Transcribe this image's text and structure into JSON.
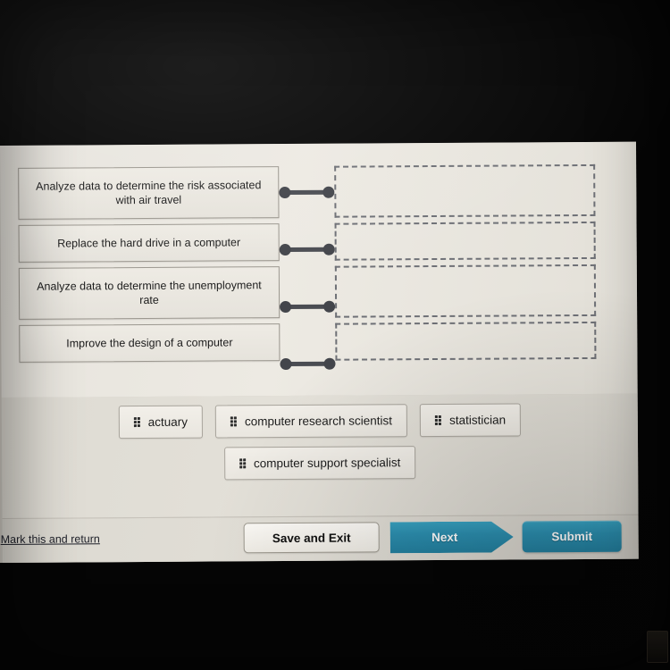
{
  "screen": {
    "prompts": [
      {
        "id": "prompt-1",
        "text": "Analyze data to determine the risk associated with air travel",
        "size": "tall"
      },
      {
        "id": "prompt-2",
        "text": "Replace the hard drive in a computer",
        "size": "short"
      },
      {
        "id": "prompt-3",
        "text": "Analyze data to determine the unemployment rate",
        "size": "tall"
      },
      {
        "id": "prompt-4",
        "text": "Improve the design of a computer",
        "size": "short"
      }
    ],
    "dropzones": [
      {
        "id": "dropzone-1",
        "value": "",
        "size": "tall"
      },
      {
        "id": "dropzone-2",
        "value": "",
        "size": "short"
      },
      {
        "id": "dropzone-3",
        "value": "",
        "size": "tall"
      },
      {
        "id": "dropzone-4",
        "value": "",
        "size": "short"
      }
    ],
    "tokens": {
      "row1": [
        {
          "id": "token-actuary",
          "label": "actuary",
          "icon": "drag-grip-icon"
        },
        {
          "id": "token-computer-research-scientist",
          "label": "computer research scientist",
          "icon": "drag-grip-icon"
        },
        {
          "id": "token-statistician",
          "label": "statistician",
          "icon": "drag-grip-icon"
        }
      ],
      "row2": [
        {
          "id": "token-computer-support-specialist",
          "label": "computer support specialist",
          "icon": "drag-grip-icon"
        }
      ]
    },
    "actions": {
      "mark_link": "Mark this and return",
      "save_label": "Save and Exit",
      "next_label": "Next",
      "submit_label": "Submit"
    },
    "colors": {
      "accent_teal": "#2c8fb0",
      "accent_teal_light": "#38a2c1",
      "page_bg": "#e7e4dd",
      "tray_bg": "#dedbd3",
      "connector": "#43454b",
      "dash_border": "#6e7076",
      "box_border": "#9b978f"
    }
  }
}
